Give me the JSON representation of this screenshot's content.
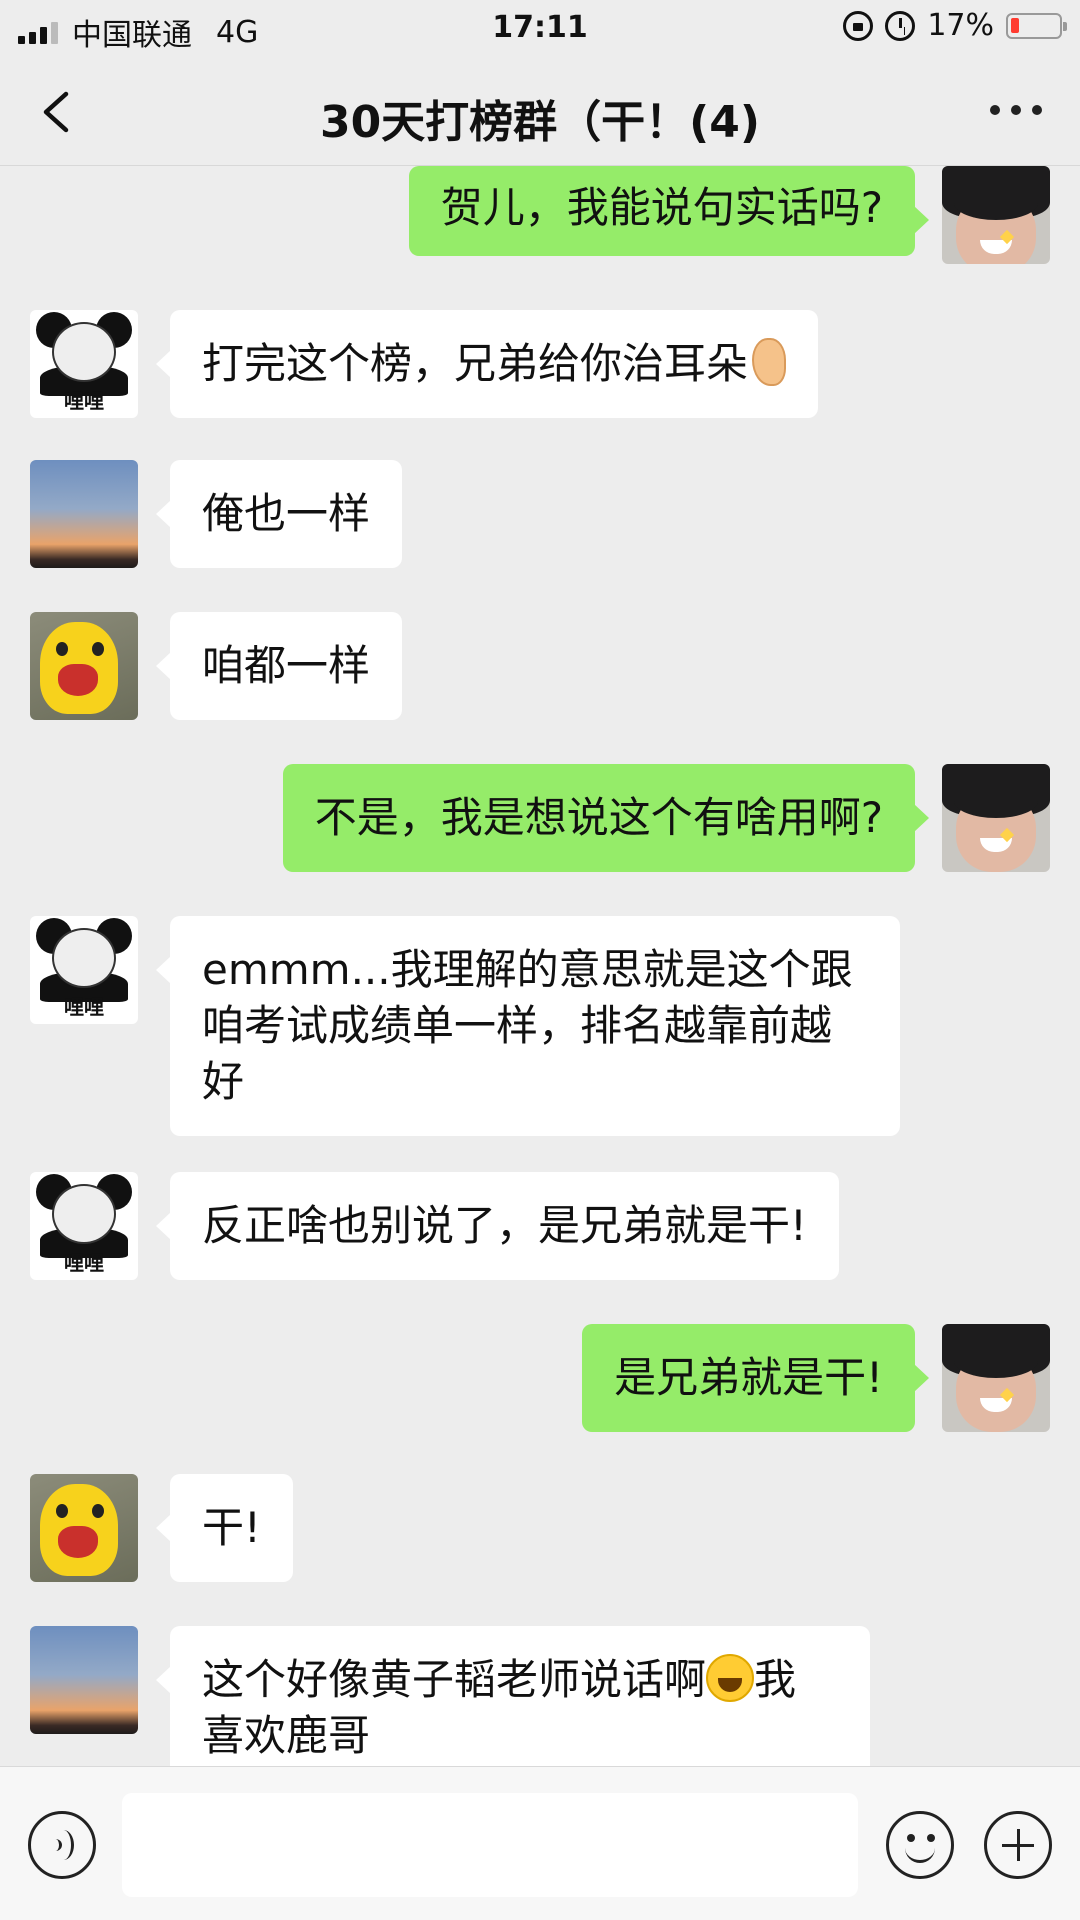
{
  "status_bar": {
    "carrier": "中国联通",
    "network": "4G",
    "time": "17:11",
    "battery": "17%",
    "battery_level": 0.17,
    "icons": [
      "signal-icon",
      "rotation-lock-icon",
      "alarm-icon",
      "battery-icon"
    ]
  },
  "nav": {
    "title": "30天打榜群（干！(4)",
    "back_icon": "chevron-left-icon",
    "more_icon": "more-dots-icon"
  },
  "messages": [
    {
      "side": "right",
      "avatar": "boy",
      "text": "贺儿，我能说句实话吗?"
    },
    {
      "side": "left",
      "avatar": "panda",
      "avatar_caption": "哩哩",
      "text": "打完这个榜，兄弟给你治耳朵",
      "emoji": "ear-emoji"
    },
    {
      "side": "left",
      "avatar": "sunset",
      "text": "俺也一样"
    },
    {
      "side": "left",
      "avatar": "pikachu",
      "text": "咱都一样"
    },
    {
      "side": "right",
      "avatar": "boy",
      "text": "不是，我是想说这个有啥用啊?"
    },
    {
      "side": "left",
      "avatar": "panda",
      "avatar_caption": "哩哩",
      "lines": [
        "emmm...我理解的意思就是这个跟",
        "咱考试成绩单一样，排名越靠前越",
        "好"
      ]
    },
    {
      "side": "left",
      "avatar": "panda",
      "avatar_caption": "哩哩",
      "text": "反正啥也别说了，是兄弟就是干!"
    },
    {
      "side": "right",
      "avatar": "boy",
      "text": "是兄弟就是干!"
    },
    {
      "side": "left",
      "avatar": "pikachu",
      "text": "干!"
    },
    {
      "side": "left",
      "avatar": "sunset",
      "lines": [
        "这个好像黄子韬老师说话啊",
        "喜欢鹿哥"
      ],
      "emoji": "laughing-tears-emoji",
      "emoji_after": "我"
    }
  ],
  "input_bar": {
    "placeholder": "",
    "icons": [
      "voice-icon",
      "emoji-icon",
      "plus-icon"
    ]
  },
  "colors": {
    "background": "#ededed",
    "outgoing_bubble": "#95ec69",
    "incoming_bubble": "#ffffff",
    "battery_low": "#ff3b30"
  }
}
